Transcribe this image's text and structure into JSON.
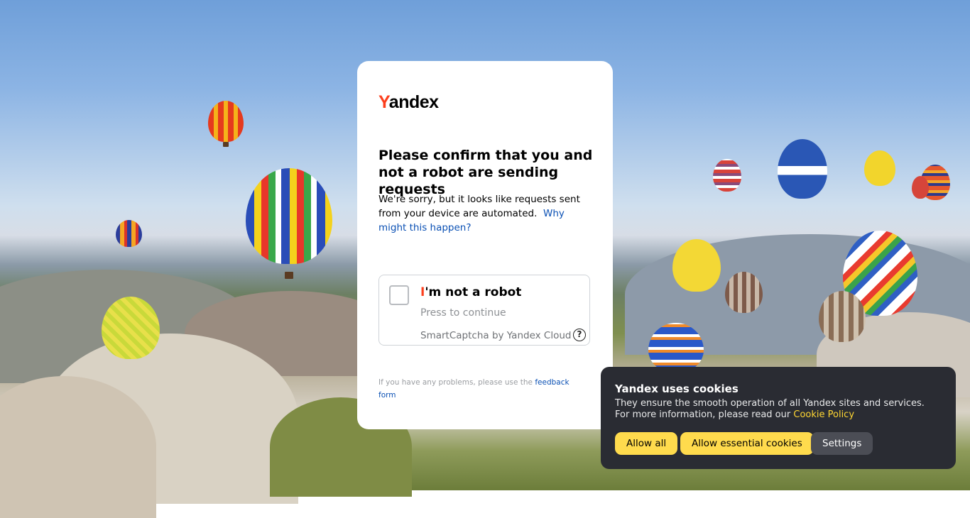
{
  "logo": {
    "y": "Y",
    "rest": "andex"
  },
  "title": "Please confirm that you and not a robot are sending requests",
  "description": {
    "text": "We're sorry, but it looks like requests sent from your device are automated.",
    "link": "Why might this happen?"
  },
  "captcha": {
    "label_first": "I",
    "label_rest": "'m not a robot",
    "subtext": "Press to continue",
    "brand": "SmartCaptcha by Yandex Cloud",
    "help_glyph": "?"
  },
  "feedback": {
    "text": "If you have any problems, please use the",
    "link": "feedback form"
  },
  "cookie": {
    "title": "Yandex uses cookies",
    "text": "They ensure the smooth operation of all Yandex sites and services. For more information, please read our",
    "link": "Cookie Policy",
    "buttons": {
      "allow_all": "Allow all",
      "allow_essential": "Allow essential cookies",
      "settings": "Settings"
    }
  },
  "colors": {
    "brand_red": "#fc3f1d",
    "link_blue": "#0a50b4",
    "cookie_bg": "#2a2c33",
    "button_yellow": "#ffdb4d"
  }
}
